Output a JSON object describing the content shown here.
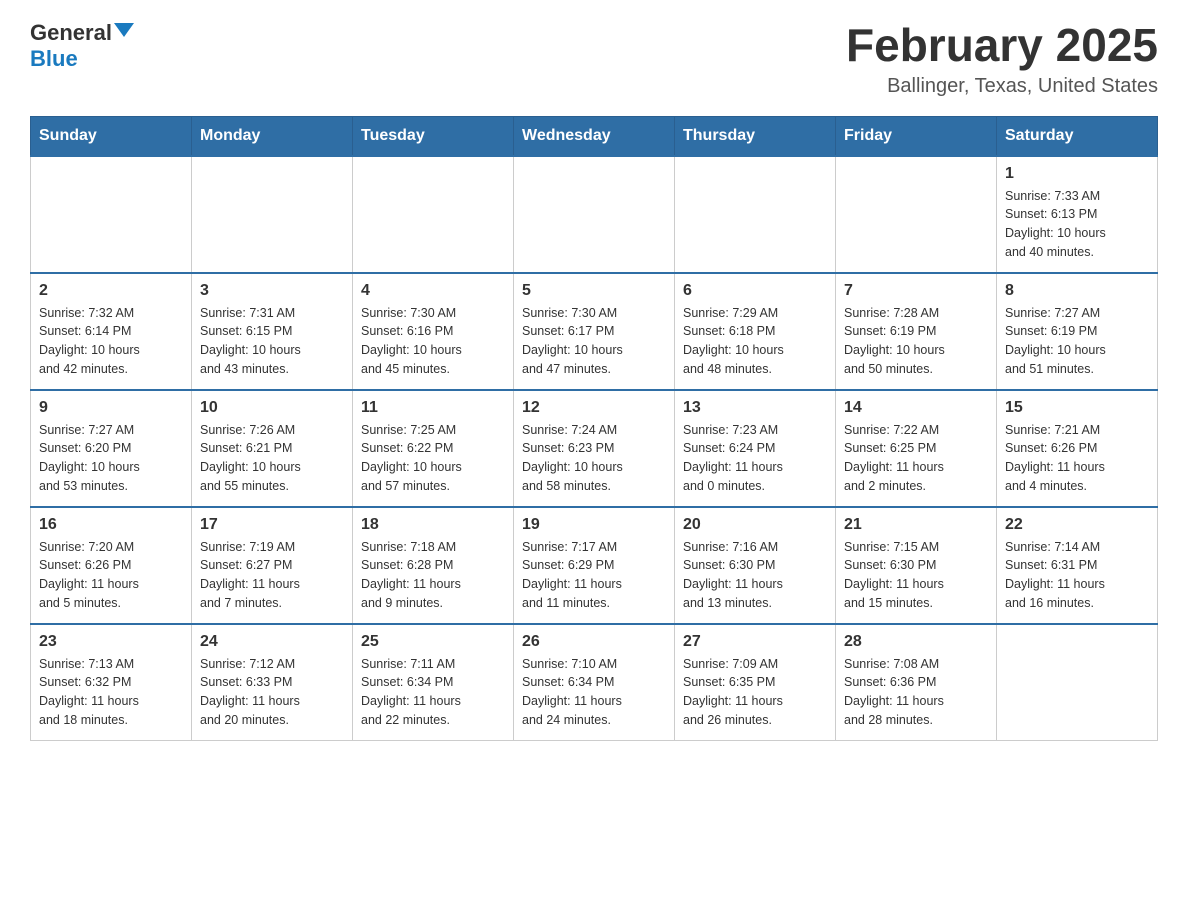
{
  "header": {
    "logo_general": "General",
    "logo_blue": "Blue",
    "month_title": "February 2025",
    "location": "Ballinger, Texas, United States"
  },
  "days_of_week": [
    "Sunday",
    "Monday",
    "Tuesday",
    "Wednesday",
    "Thursday",
    "Friday",
    "Saturday"
  ],
  "weeks": [
    [
      {
        "day": "",
        "info": ""
      },
      {
        "day": "",
        "info": ""
      },
      {
        "day": "",
        "info": ""
      },
      {
        "day": "",
        "info": ""
      },
      {
        "day": "",
        "info": ""
      },
      {
        "day": "",
        "info": ""
      },
      {
        "day": "1",
        "info": "Sunrise: 7:33 AM\nSunset: 6:13 PM\nDaylight: 10 hours\nand 40 minutes."
      }
    ],
    [
      {
        "day": "2",
        "info": "Sunrise: 7:32 AM\nSunset: 6:14 PM\nDaylight: 10 hours\nand 42 minutes."
      },
      {
        "day": "3",
        "info": "Sunrise: 7:31 AM\nSunset: 6:15 PM\nDaylight: 10 hours\nand 43 minutes."
      },
      {
        "day": "4",
        "info": "Sunrise: 7:30 AM\nSunset: 6:16 PM\nDaylight: 10 hours\nand 45 minutes."
      },
      {
        "day": "5",
        "info": "Sunrise: 7:30 AM\nSunset: 6:17 PM\nDaylight: 10 hours\nand 47 minutes."
      },
      {
        "day": "6",
        "info": "Sunrise: 7:29 AM\nSunset: 6:18 PM\nDaylight: 10 hours\nand 48 minutes."
      },
      {
        "day": "7",
        "info": "Sunrise: 7:28 AM\nSunset: 6:19 PM\nDaylight: 10 hours\nand 50 minutes."
      },
      {
        "day": "8",
        "info": "Sunrise: 7:27 AM\nSunset: 6:19 PM\nDaylight: 10 hours\nand 51 minutes."
      }
    ],
    [
      {
        "day": "9",
        "info": "Sunrise: 7:27 AM\nSunset: 6:20 PM\nDaylight: 10 hours\nand 53 minutes."
      },
      {
        "day": "10",
        "info": "Sunrise: 7:26 AM\nSunset: 6:21 PM\nDaylight: 10 hours\nand 55 minutes."
      },
      {
        "day": "11",
        "info": "Sunrise: 7:25 AM\nSunset: 6:22 PM\nDaylight: 10 hours\nand 57 minutes."
      },
      {
        "day": "12",
        "info": "Sunrise: 7:24 AM\nSunset: 6:23 PM\nDaylight: 10 hours\nand 58 minutes."
      },
      {
        "day": "13",
        "info": "Sunrise: 7:23 AM\nSunset: 6:24 PM\nDaylight: 11 hours\nand 0 minutes."
      },
      {
        "day": "14",
        "info": "Sunrise: 7:22 AM\nSunset: 6:25 PM\nDaylight: 11 hours\nand 2 minutes."
      },
      {
        "day": "15",
        "info": "Sunrise: 7:21 AM\nSunset: 6:26 PM\nDaylight: 11 hours\nand 4 minutes."
      }
    ],
    [
      {
        "day": "16",
        "info": "Sunrise: 7:20 AM\nSunset: 6:26 PM\nDaylight: 11 hours\nand 5 minutes."
      },
      {
        "day": "17",
        "info": "Sunrise: 7:19 AM\nSunset: 6:27 PM\nDaylight: 11 hours\nand 7 minutes."
      },
      {
        "day": "18",
        "info": "Sunrise: 7:18 AM\nSunset: 6:28 PM\nDaylight: 11 hours\nand 9 minutes."
      },
      {
        "day": "19",
        "info": "Sunrise: 7:17 AM\nSunset: 6:29 PM\nDaylight: 11 hours\nand 11 minutes."
      },
      {
        "day": "20",
        "info": "Sunrise: 7:16 AM\nSunset: 6:30 PM\nDaylight: 11 hours\nand 13 minutes."
      },
      {
        "day": "21",
        "info": "Sunrise: 7:15 AM\nSunset: 6:30 PM\nDaylight: 11 hours\nand 15 minutes."
      },
      {
        "day": "22",
        "info": "Sunrise: 7:14 AM\nSunset: 6:31 PM\nDaylight: 11 hours\nand 16 minutes."
      }
    ],
    [
      {
        "day": "23",
        "info": "Sunrise: 7:13 AM\nSunset: 6:32 PM\nDaylight: 11 hours\nand 18 minutes."
      },
      {
        "day": "24",
        "info": "Sunrise: 7:12 AM\nSunset: 6:33 PM\nDaylight: 11 hours\nand 20 minutes."
      },
      {
        "day": "25",
        "info": "Sunrise: 7:11 AM\nSunset: 6:34 PM\nDaylight: 11 hours\nand 22 minutes."
      },
      {
        "day": "26",
        "info": "Sunrise: 7:10 AM\nSunset: 6:34 PM\nDaylight: 11 hours\nand 24 minutes."
      },
      {
        "day": "27",
        "info": "Sunrise: 7:09 AM\nSunset: 6:35 PM\nDaylight: 11 hours\nand 26 minutes."
      },
      {
        "day": "28",
        "info": "Sunrise: 7:08 AM\nSunset: 6:36 PM\nDaylight: 11 hours\nand 28 minutes."
      },
      {
        "day": "",
        "info": ""
      }
    ]
  ]
}
